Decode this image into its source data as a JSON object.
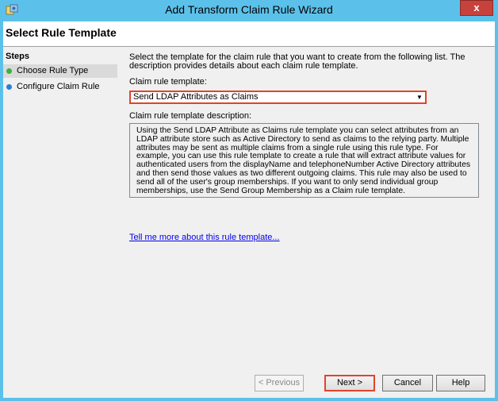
{
  "window": {
    "title": "Add Transform Claim Rule Wizard",
    "close_label": "x"
  },
  "page_title": "Select Rule Template",
  "steps": {
    "heading": "Steps",
    "items": [
      {
        "label": "Choose Rule Type",
        "state": "current",
        "dot_color": "#3cb043"
      },
      {
        "label": "Configure Claim Rule",
        "state": "pending",
        "dot_color": "#2a7fd4"
      }
    ]
  },
  "content": {
    "intro": "Select the template for the claim rule that you want to create from the following list. The description provides details about each claim rule template.",
    "template_label": "Claim rule template:",
    "template_value": "Send LDAP Attributes as Claims",
    "description_label": "Claim rule template description:",
    "description": "Using the Send LDAP Attribute as Claims rule template you can select attributes from an LDAP attribute store such as Active Directory to send as claims to the relying party. Multiple attributes may be sent as multiple claims from a single rule using this rule type. For example, you can use this rule template to create a rule that will extract attribute values for authenticated users from the displayName and telephoneNumber Active Directory attributes and then send those values as two different outgoing claims. This rule may also be used to send all of the user's group memberships. If you want to only send individual group memberships, use the Send Group Membership as a Claim rule template.",
    "more_link": "Tell me more about this rule template..."
  },
  "buttons": {
    "previous": "< Previous",
    "next": "Next >",
    "cancel": "Cancel",
    "help": "Help"
  },
  "colors": {
    "title_bar": "#5cc1ea",
    "highlight": "#e2432b",
    "link": "#0000ee"
  }
}
